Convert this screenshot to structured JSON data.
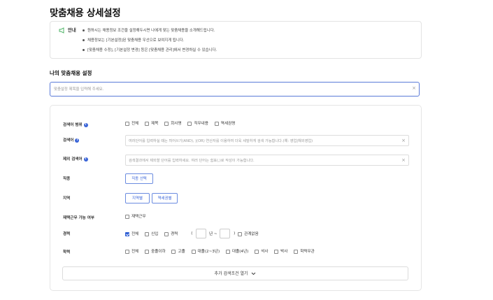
{
  "page": {
    "title": "맞춤채용 상세설정"
  },
  "notice": {
    "icon": "megaphone-icon",
    "label": "안내",
    "lines": [
      "원하시는 채용정보 조건을 설정해두시면 나에게 맞는 맞춤채용을 소개해드립니다.",
      "채용정보는 [기본설정]된 맞춤채용 우선으로 보여지게 됩니다.",
      "[맞춤채용 수정], [기본설정 변경] 등은 [맞춤채용 관리]에서 변경하실 수 있습니다."
    ]
  },
  "my_settings": {
    "section_title": "나의 맞춤채용 설정",
    "name_placeholder": "맞춤설정 제목을 입력해 주세요.",
    "clear": "×"
  },
  "form": {
    "search_scope": {
      "label": "검색어 범위",
      "options": [
        {
          "label": "전체",
          "checked": false
        },
        {
          "label": "제목",
          "checked": false
        },
        {
          "label": "회사명",
          "checked": false
        },
        {
          "label": "직무내용",
          "checked": false
        },
        {
          "label": "역세권명",
          "checked": false
        }
      ]
    },
    "keyword": {
      "label": "검색어",
      "placeholder": "여러단어를 입력하실 때는 띄어쓰기(AND), |(OR) 연산자를 이용하여 더욱 세밀하게 검색 가능합니다.(예: 영업|해외영업)",
      "clear": "×"
    },
    "exclude_keyword": {
      "label": "제외 검색어",
      "placeholder": "검색결과에서 제외할 단어를 입력하세요. 여러 단어는 쉼표(,)로 작성이 가능합니다.",
      "clear": "×"
    },
    "job": {
      "label": "직종",
      "button": "직종 선택"
    },
    "region": {
      "label": "지역",
      "buttons": [
        "지역별",
        "역세권별"
      ]
    },
    "remote": {
      "label": "재택근무 가능 여부",
      "option": {
        "label": "재택근무",
        "checked": false
      }
    },
    "career": {
      "label": "경력",
      "options": [
        {
          "label": "전체",
          "checked": true
        },
        {
          "label": "신입",
          "checked": false
        },
        {
          "label": "경력",
          "checked": false
        }
      ],
      "paren_open": "(",
      "years_sep": "년 ~",
      "paren_close": ")",
      "irrelevant": {
        "label": "관계없음",
        "checked": false
      }
    },
    "education": {
      "label": "학력",
      "options": [
        {
          "label": "전체",
          "checked": false
        },
        {
          "label": "중졸이하",
          "checked": false
        },
        {
          "label": "고졸",
          "checked": false
        },
        {
          "label": "대졸(2~3년)",
          "checked": false
        },
        {
          "label": "대졸(4년)",
          "checked": false
        },
        {
          "label": "석사",
          "checked": false
        },
        {
          "label": "박사",
          "checked": false
        },
        {
          "label": "학력무관",
          "checked": false
        }
      ]
    },
    "more_button": "추가 검색조건 열기",
    "more_icon": "chevron-down-icon"
  },
  "colors": {
    "accent": "#3b65d8",
    "check": "#2f5fd4"
  }
}
